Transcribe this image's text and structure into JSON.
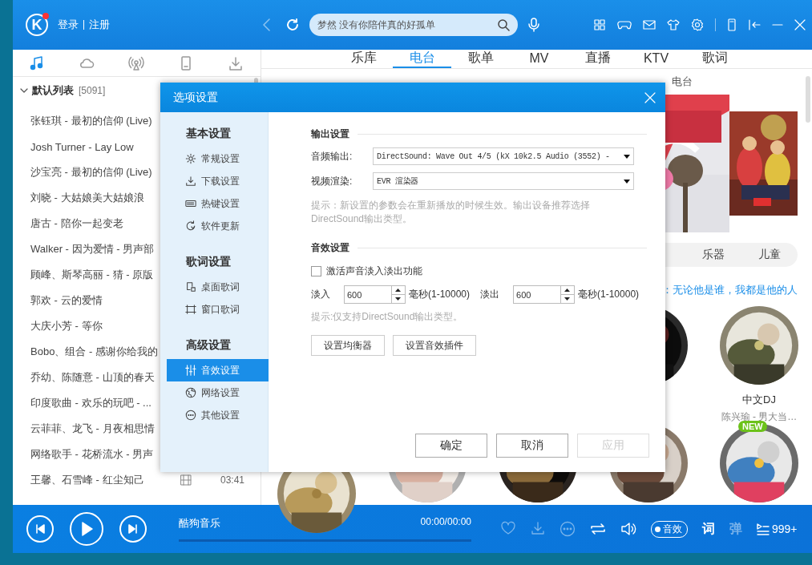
{
  "topbar": {
    "logo": "K",
    "login": "登录",
    "register": "注册",
    "search": {
      "placeholder": "梦然 没有你陪伴真的好孤单"
    }
  },
  "left_tabs": [
    {
      "selected": true
    },
    {
      "selected": false
    },
    {
      "selected": false
    },
    {
      "selected": false
    },
    {
      "selected": false
    }
  ],
  "playlist": {
    "name": "默认列表",
    "count": "[5091]",
    "expanded": true,
    "songs": [
      {
        "title": "张钰琪 - 最初的信仰 (Live)"
      },
      {
        "title": "Josh Turner - Lay Low"
      },
      {
        "title": "沙宝亮 - 最初的信仰 (Live)"
      },
      {
        "title": "刘晓 - 大姑娘美大姑娘浪"
      },
      {
        "title": "唐古 - 陪你一起变老"
      },
      {
        "title": "Walker - 因为爱情 - 男声部"
      },
      {
        "title": "顾峰、斯琴高丽 - 猜 - 原版"
      },
      {
        "title": "郭欢 - 云的爱情"
      },
      {
        "title": "大庆小芳 - 等你"
      },
      {
        "title": "Bobo、组合 - 感谢你给我的"
      },
      {
        "title": "乔幼、陈随意 - 山顶的春天"
      },
      {
        "title": "印度歌曲 - 欢乐的玩吧 - ..."
      },
      {
        "title": "云菲菲、龙飞 - 月夜相思情"
      },
      {
        "title": "网络歌手 - 花桥流水 - 男声"
      },
      {
        "title": "王馨、石雪峰 - 红尘知己",
        "duration": "03:41"
      }
    ]
  },
  "nav_tabs": [
    {
      "label": "乐库",
      "selected": false
    },
    {
      "label": "电台",
      "selected": true
    },
    {
      "label": "歌单",
      "selected": false
    },
    {
      "label": "MV",
      "selected": false
    },
    {
      "label": "直播",
      "selected": false
    },
    {
      "label": "KTV",
      "selected": false
    },
    {
      "label": "歌词",
      "selected": false
    }
  ],
  "radio": {
    "section_title": "电台",
    "categories": [
      "乐器",
      "儿童"
    ],
    "headline": "：无论他是谁，我都是他的人",
    "stations": [
      {
        "kind": "picture"
      },
      {
        "kind": "picture",
        "title": "中文DJ",
        "subtitle": "陈兴瑜 - 男大当…"
      },
      {
        "kind": "picture"
      },
      {
        "kind": "picture"
      },
      {
        "kind": "picture"
      },
      {
        "kind": "picture"
      },
      {
        "kind": "picture",
        "badge": "NEW"
      }
    ]
  },
  "player": {
    "title": "酷狗音乐",
    "time": "00:00/00:00",
    "progress": {
      "level": 0
    },
    "effect": "音效",
    "lyrics": "词",
    "danmaku": "弹",
    "queue_count": "999+"
  },
  "dialog": {
    "title": "选项设置",
    "nav": [
      {
        "title": "基本设置",
        "items": [
          {
            "label": "常规设置",
            "selected": false
          },
          {
            "label": "下载设置",
            "selected": false
          },
          {
            "label": "热键设置",
            "selected": false
          },
          {
            "label": "软件更新",
            "selected": false
          }
        ]
      },
      {
        "title": "歌词设置",
        "items": [
          {
            "label": "桌面歌词",
            "selected": false
          },
          {
            "label": "窗口歌词",
            "selected": false
          }
        ]
      },
      {
        "title": "高级设置",
        "items": [
          {
            "label": "音效设置",
            "selected": true
          },
          {
            "label": "网络设置",
            "selected": false
          },
          {
            "label": "其他设置",
            "selected": false
          }
        ]
      }
    ],
    "output": {
      "title": "输出设置",
      "fields": [
        {
          "label": "音频输出:",
          "value": "DirectSound: Wave Out 4/5 (kX 10k2.5 Audio (3552) -"
        },
        {
          "label": "视频渲染:",
          "value": "EVR 渲染器"
        }
      ],
      "hint": "提示：新设置的参数会在重新播放的时候生效。输出设备推荐选择DirectSound输出类型。"
    },
    "effects": {
      "title": "音效设置",
      "fade": {
        "label": "激活声音淡入淡出功能",
        "checked": false
      },
      "fade_in": {
        "label": "淡入",
        "value": "600",
        "unit": "毫秒(1-10000)"
      },
      "fade_out": {
        "label": "淡出",
        "value": "600",
        "unit": "毫秒(1-10000)"
      },
      "hint": "提示:仅支持DirectSound输出类型。",
      "buttons": [
        "设置均衡器",
        "设置音效插件"
      ]
    },
    "footer": [
      {
        "label": "确定",
        "disabled": false
      },
      {
        "label": "取消",
        "disabled": false
      },
      {
        "label": "应用",
        "disabled": true
      }
    ]
  }
}
